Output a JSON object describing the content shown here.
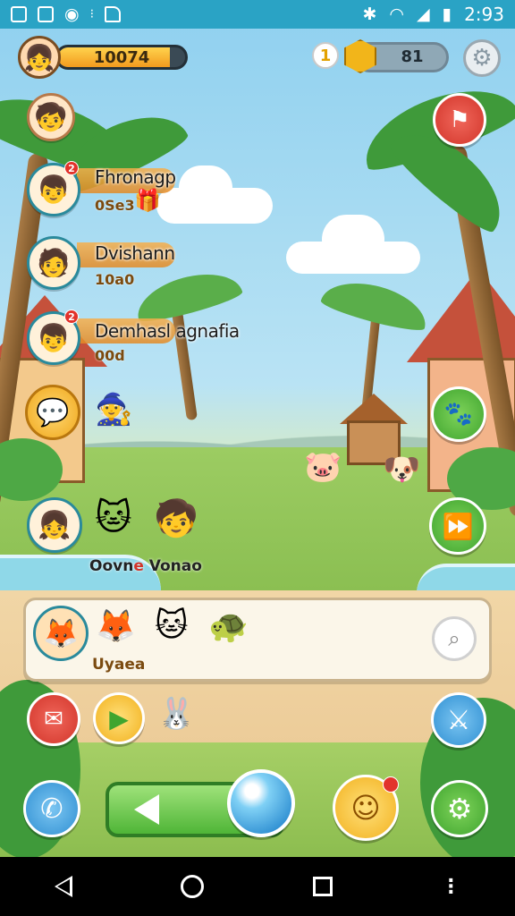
{
  "status_bar": {
    "time": "2:93",
    "icons": [
      "notification-icon",
      "image-icon",
      "shield-icon",
      "dots-icon",
      "file-icon",
      "vibrate-icon",
      "wifi-icon",
      "signal-icon",
      "battery-icon"
    ]
  },
  "hud": {
    "xp_value": "10074",
    "xp_fill_fraction": 0.88,
    "info_label": "1",
    "coins": "81"
  },
  "friends": [
    {
      "name": "Fhronagp",
      "score": "0Se3",
      "badge": "2"
    },
    {
      "name": "Dvishann",
      "score": "10a0",
      "badge": ""
    },
    {
      "name": "Demhasl agnafia",
      "score": "00d",
      "badge": "2"
    }
  ],
  "group": {
    "label_prefix": "Oovn",
    "label_highlight": "e",
    "label_suffix": " Vonao"
  },
  "panel": {
    "label": "Uyaea"
  },
  "colors": {
    "status_bar": "#2aa3c5",
    "accent_orange": "#f29a1e",
    "button_red": "#d2352a",
    "button_green": "#3fa52f",
    "button_blue": "#2f8fd2"
  }
}
